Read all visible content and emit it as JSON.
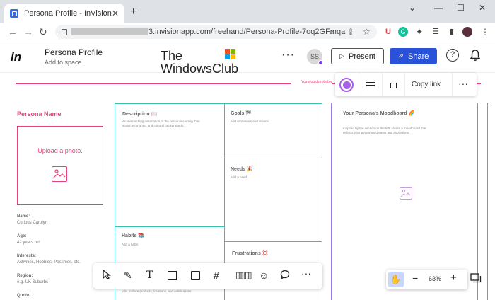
{
  "browser": {
    "tab_title": "Persona Profile - InVision",
    "tab_close": "✕",
    "new_tab": "+",
    "url_visible": "3.invisionapp.com/freehand/Persona-Profile-7oq2GFmqa"
  },
  "header": {
    "logo": "in",
    "title": "Persona Profile",
    "subtitle": "Add to space",
    "watermark_line1": "The",
    "watermark_line2": "WindowsClub",
    "more": "···",
    "avatar_initials": "SS",
    "present_label": "Present",
    "share_label": "Share",
    "help": "?"
  },
  "canvas": {
    "tiny_text": "You would probably",
    "persona_name_label": "Persona Name",
    "upload_label": "Upload a photo.",
    "fields": [
      {
        "label": "Name:",
        "value": "Curious Carolyn"
      },
      {
        "label": "Age:",
        "value": "42 years old"
      },
      {
        "label": "Interests:",
        "value": "Activities, Hobbies, Pastimes, etc."
      },
      {
        "label": "Region:",
        "value": "e.g. UK Suburbs"
      },
      {
        "label": "Quote:",
        "value": ""
      }
    ],
    "description": {
      "title": "Description 📖",
      "text": "An overarching description of the person including their social, economic, and cultural backgrounds."
    },
    "goals": {
      "title": "Goals 🏁",
      "text": "Add motivators and visions."
    },
    "needs": {
      "title": "Needs 🎉",
      "text": "Add a need."
    },
    "habits": {
      "title": "Habits 📚",
      "text": "Add a habit."
    },
    "frustrations": {
      "title": "Frustrations 💢",
      "text": ""
    },
    "habits_bottom_text": "jobs, culture products, locations, and celebrations.",
    "moodboard": {
      "title": "Your Persona's Moodboard 🌈",
      "text": "Inspired by the section on the left, create a moodboard that reflects your persona's dreams and aspirations."
    }
  },
  "float_toolbar": {
    "copy_link": "Copy link",
    "more": "···",
    "color": "#a760e8"
  },
  "zoom": {
    "minus": "−",
    "value": "63%",
    "plus": "+"
  },
  "colors": {
    "accent": "#2a52d9",
    "persona_pink": "#e8417a",
    "teal": "#35c2b0",
    "purple": "#9c7bee"
  }
}
